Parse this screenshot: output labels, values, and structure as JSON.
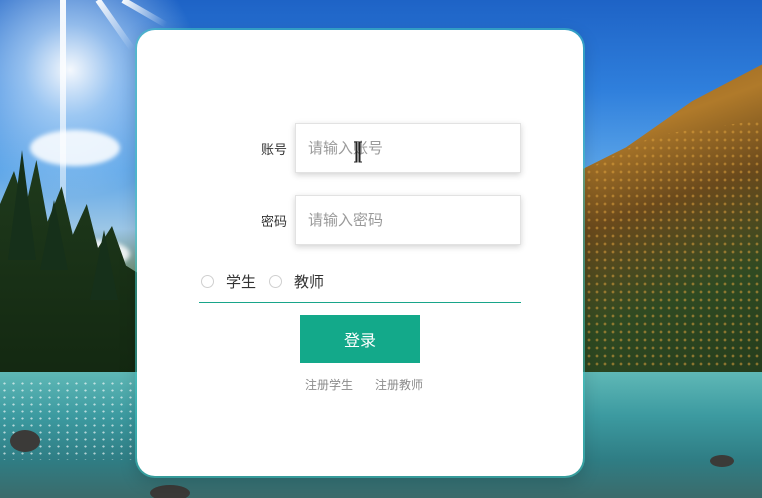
{
  "login_form": {
    "account_label": "账号",
    "account_placeholder": "请输入账号",
    "password_label": "密码",
    "password_placeholder": "请输入密码",
    "role_options": [
      {
        "label": "学生",
        "selected": false
      },
      {
        "label": "教师",
        "selected": false
      }
    ],
    "login_button_label": "登录",
    "register_links": [
      "注册学生",
      "注册教师"
    ]
  },
  "colors": {
    "accent": "#13a98a",
    "card_background": "#ffffff",
    "label_text": "#333333",
    "placeholder_text": "#9a9a9a",
    "link_text": "#8c8c8c"
  },
  "icons": {
    "text_cursor": "i-beam-cursor-icon"
  }
}
